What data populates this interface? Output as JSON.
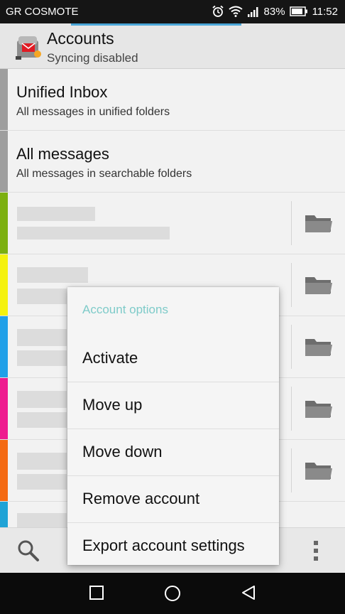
{
  "status_bar": {
    "carrier": "GR COSMOTE",
    "battery": "83%",
    "time": "11:52"
  },
  "app_bar": {
    "title": "Accounts",
    "subtitle": "Syncing disabled"
  },
  "accounts": [
    {
      "name": "Unified Inbox",
      "description": "All messages in unified folders",
      "color": "#9e9e9e"
    },
    {
      "name": "All messages",
      "description": "All messages in searchable folders",
      "color": "#9e9e9e"
    },
    {
      "name": "",
      "description": "",
      "color": "#7cb011"
    },
    {
      "name": "",
      "description": "",
      "color": "#f5f20f"
    },
    {
      "name": "",
      "description": "",
      "color": "#21a0e8"
    },
    {
      "name": "",
      "description": "",
      "color": "#ee1b8f"
    },
    {
      "name": "",
      "description": "",
      "color": "#f46a12"
    },
    {
      "name": "",
      "description": "",
      "color": "#20a3d6"
    }
  ],
  "context_menu": {
    "header": "Account options",
    "items": [
      "Activate",
      "Move up",
      "Move down",
      "Remove account",
      "Export account settings"
    ]
  },
  "icons": {
    "folder": "folder-icon",
    "search": "search-icon",
    "overflow": "overflow-menu-icon",
    "nav_recent": "square-recents-icon",
    "nav_home": "circle-home-icon",
    "nav_back": "triangle-back-icon"
  }
}
